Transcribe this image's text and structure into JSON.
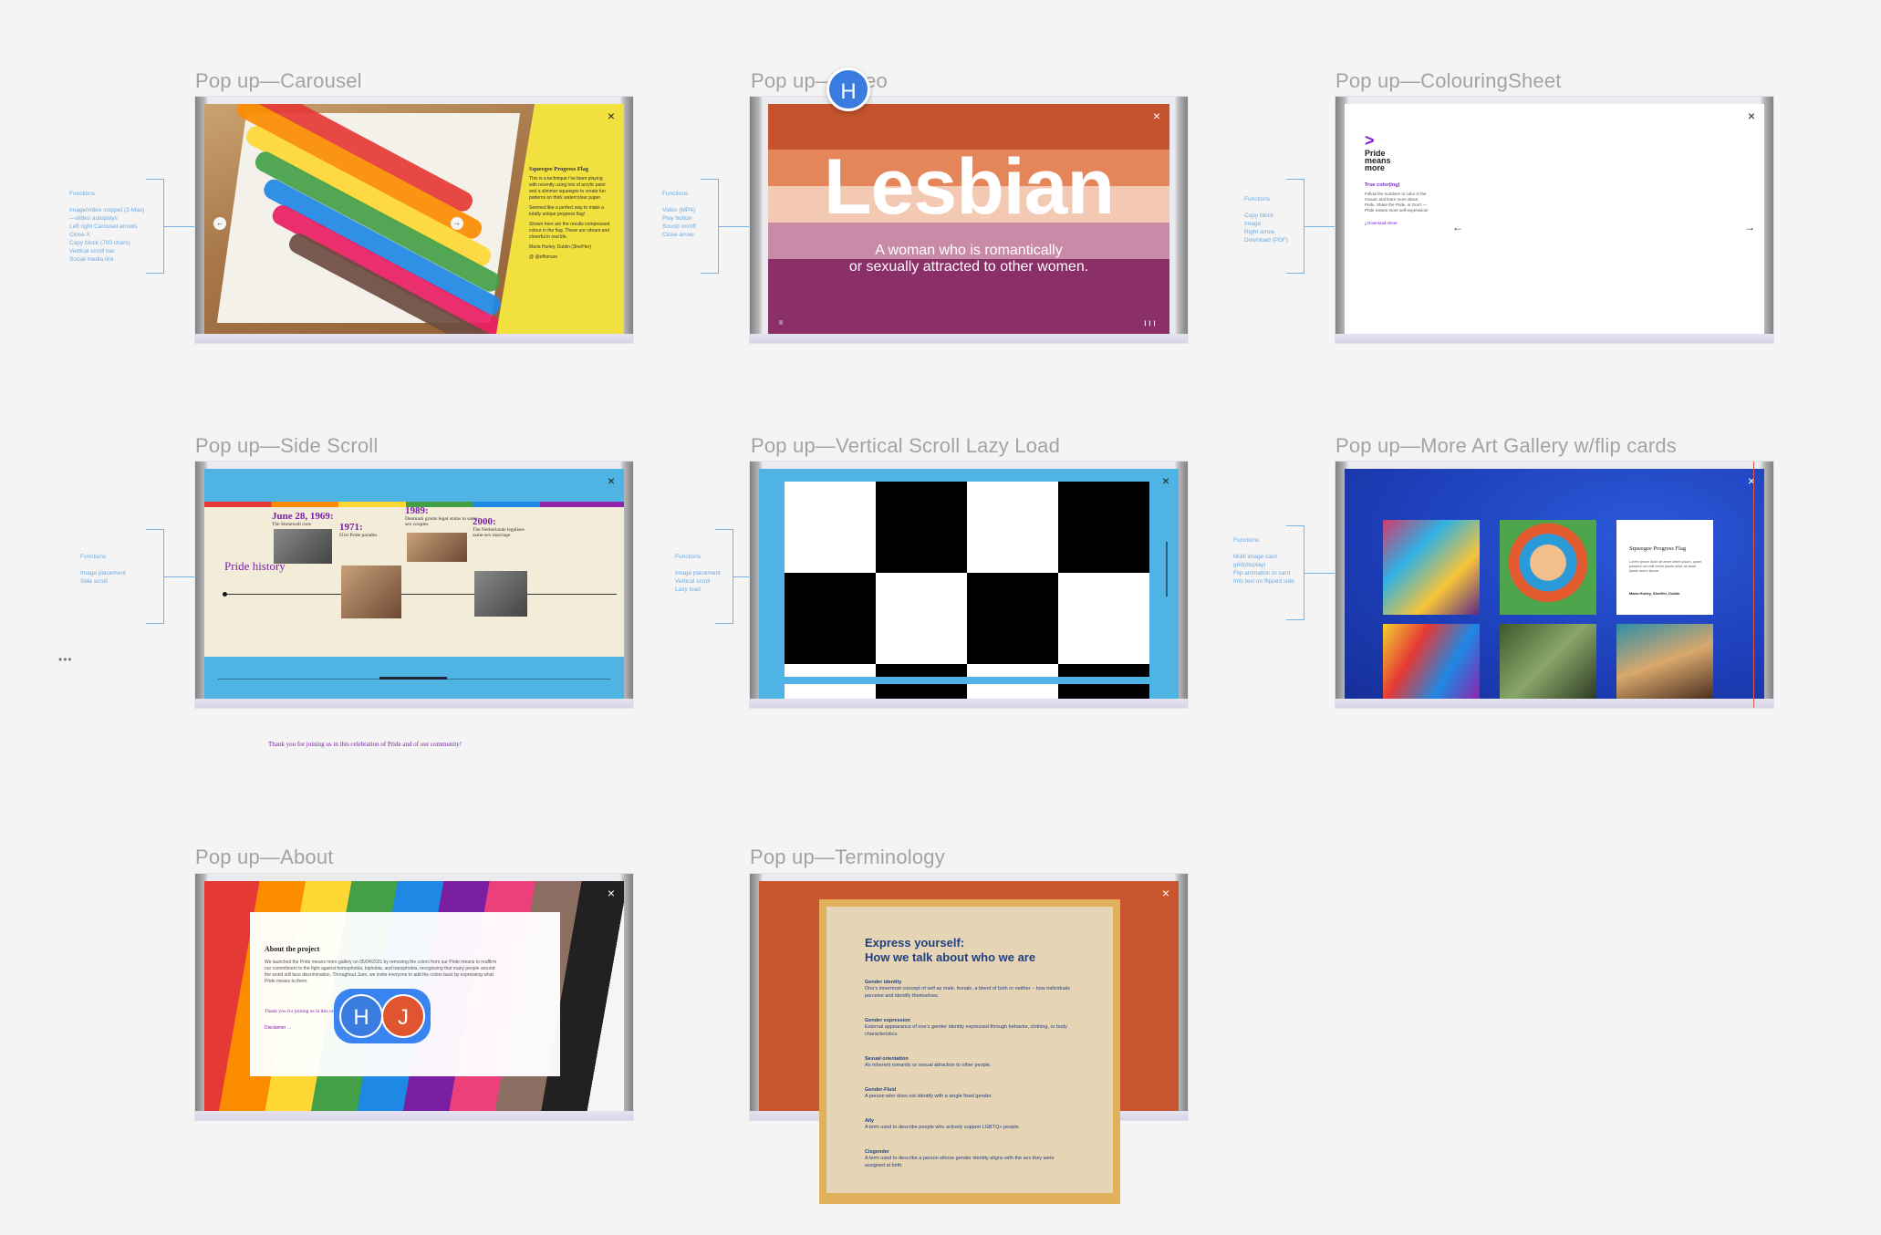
{
  "frames": {
    "carousel": {
      "label": "Pop up—Carousel",
      "annotation": {
        "title": "Functions",
        "lines": [
          "Image/video snippet (3-Max)",
          "—slides autoplays",
          "Left right Carousel arrows",
          "Close X",
          "Copy block (700 chars)",
          "Vertical scroll bar",
          "Social media link"
        ]
      },
      "panel_title": "Squeegee Progress Flag",
      "panel_body_1": "This is a technique I’ve been playing with recently using lots of acrylic paint and a slimmer squeegee to create fun patterns on thick watercolour paper.",
      "panel_body_2": "Seemed like a perfect way to make a totally unique progress flag!",
      "panel_body_3": "Shown here are the results compressed colour in the flag. These are vibrant and cheerful in real life.",
      "panel_author": "Maria Hurley, Dublin (She/Her)",
      "panel_social": "@ @effomare",
      "arrow_left": "←",
      "arrow_right": "→"
    },
    "video": {
      "label": "Pop up—Video",
      "annotation": {
        "title": "Functions",
        "lines": [
          "Video (MP4)",
          "Play button",
          "Sound on/off",
          "Close arrow"
        ]
      },
      "title": "Lesbian",
      "subtitle_1": "A woman who is romantically",
      "subtitle_2": "or sexually attracted to other women.",
      "pause": "II",
      "sound": "❙❙❙"
    },
    "colouring": {
      "label": "Pop up—ColouringSheet",
      "annotation": {
        "title": "Functions",
        "lines": [
          "Copy block",
          "Image",
          "Right arrow",
          "Download (PDF)"
        ]
      },
      "logo": ">",
      "brand": "Pride means more",
      "subtitle": "True color(ing)",
      "body": "Follow the numbers to color in the mosaic and learn more about Pride. Share the Pride, or Don’t — Pride means more self-expression!",
      "download": "Download sheet",
      "arrow_left": "←",
      "arrow_right": "→"
    },
    "side_scroll": {
      "label": "Pop up—Side Scroll",
      "annotation": {
        "title": "Functions",
        "lines": [
          "Image placement",
          "Side scroll"
        ]
      },
      "title": "Pride history",
      "events": [
        {
          "year": "June 28, 1969:",
          "caption": "The Stonewall riots"
        },
        {
          "year": "1971:",
          "caption": "First Pride parades"
        },
        {
          "year": "1989:",
          "caption": "Denmark grants legal status to same sex couples"
        },
        {
          "year": "2000:",
          "caption": "The Netherlands legalises same-sex marriage"
        }
      ],
      "footer": "Thank you for joining us in this celebration of Pride and of our community!"
    },
    "vertical_scroll": {
      "label": "Pop up—Vertical Scroll Lazy Load",
      "annotation": {
        "title": "Functions",
        "lines": [
          "Image placement",
          "Vertical scroll",
          "Lazy load"
        ]
      }
    },
    "gallery": {
      "label": "Pop up—More Art Gallery w/flip cards",
      "annotation": {
        "title": "Functions",
        "lines": [
          "Multi image card grid(display)",
          "Flip animation to card",
          "Info text on flipped side"
        ]
      },
      "card_title": "Squeegee Progress Flag",
      "card_body": "Lorem ipsum dolor sit amet lorem ipsum, quam posuere vel velit lorem ipsum dolor sit amet ipsum lorem ipsum.",
      "card_author": "Maria Hurley, She/Her, Dublin"
    },
    "about": {
      "label": "Pop up—About",
      "title": "About the project",
      "body": "We launched the Pride means more gallery on 05/04/2021 by removing the colors from our Pride means to reaffirm our commitment to the fight against homophobia, biphobia, and transphobia, recognizing that many people around the world still face discrimination. Throughout June, we invite everyone to add the colors back by expressing what Pride means to them.",
      "thanks": "Thank you for joining us in this celebration of Pride and of our community!",
      "link": "Disclaimer →"
    },
    "terminology": {
      "label": "Pop up—Terminology",
      "title_1": "Express yourself:",
      "title_2": "How we talk about who we are",
      "terms": [
        {
          "term": "Gender identity",
          "def": "One’s innermost concept of self as male, female, a blend of both or neither – how individuals perceive and identify themselves."
        },
        {
          "term": "Gender expression",
          "def": "External appearance of one’s gender identity expressed through behavior, clothing, or body characteristics."
        },
        {
          "term": "Sexual orientation",
          "def": "An inherent romantic or sexual attraction to other people."
        },
        {
          "term": "Gender-Fluid",
          "def": "A person who does not identify with a single fixed gender."
        },
        {
          "term": "Ally",
          "def": "A term used to describe people who actively support LGBTQ+ people."
        },
        {
          "term": "Cisgender",
          "def": "A term used to describe a person whose gender identity aligns with the sex they were assigned at birth."
        }
      ]
    }
  },
  "close_label": "×",
  "collaborators": [
    {
      "initial": "H",
      "color": "#3a7be0"
    },
    {
      "initial": "H",
      "color": "#3a7be0"
    },
    {
      "initial": "J",
      "color": "#e0552f"
    }
  ],
  "more_dots": "•••",
  "colors": {
    "accent_blue": "#6fa9dd",
    "lesbian_top": "#c4532d",
    "lesbian_mid": "#f2a77a",
    "lesbian_bottom": "#8a2f68",
    "gallery_blue": "#1d3eb8",
    "terminology_orange": "#c9562f"
  }
}
